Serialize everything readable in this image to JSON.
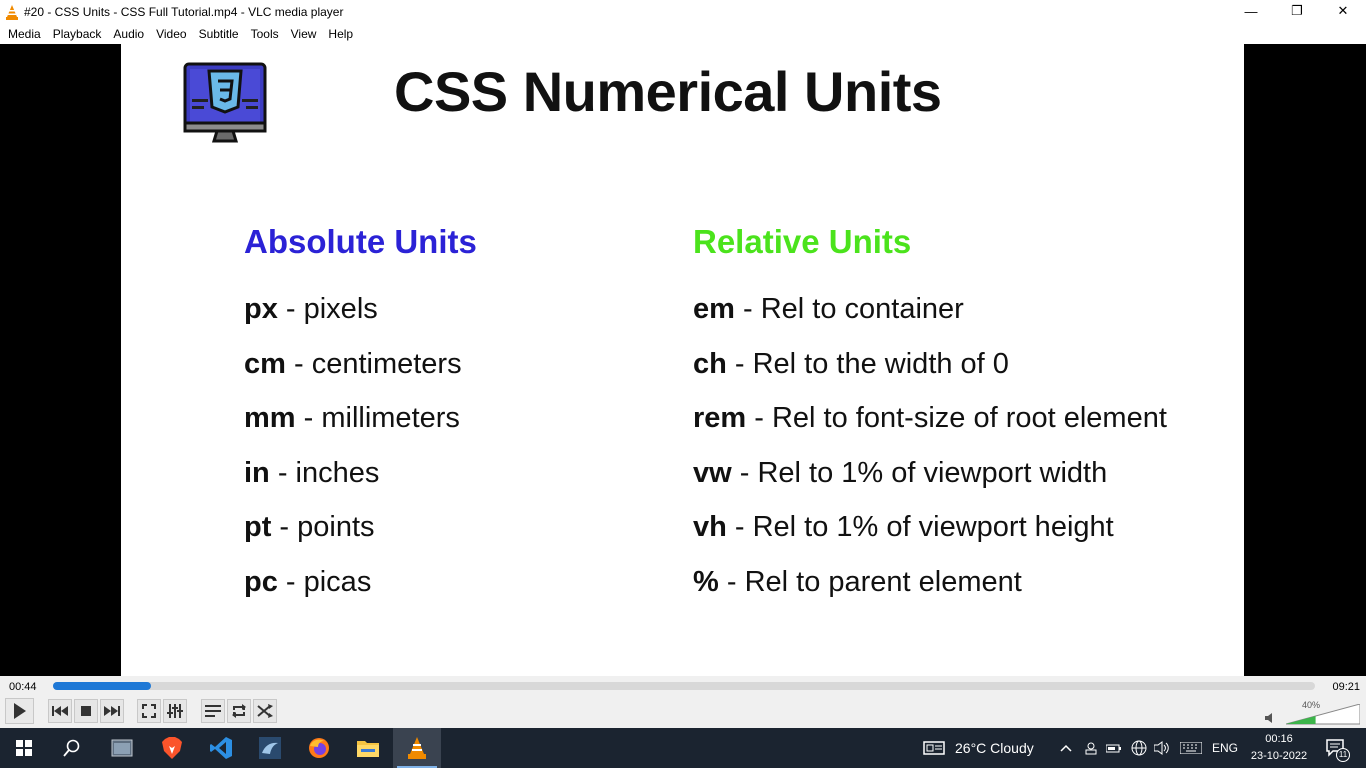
{
  "window": {
    "title": "#20 - CSS Units - CSS Full Tutorial.mp4 - VLC media player",
    "minimize_glyph": "—",
    "maximize_glyph": "❐",
    "close_glyph": "✕"
  },
  "menu": [
    "Media",
    "Playback",
    "Audio",
    "Video",
    "Subtitle",
    "Tools",
    "View",
    "Help"
  ],
  "slide": {
    "title": "CSS Numerical Units",
    "absolute": {
      "heading": "Absolute Units",
      "items": [
        {
          "unit": "px",
          "desc": " - pixels"
        },
        {
          "unit": "cm",
          "desc": " - centimeters"
        },
        {
          "unit": "mm",
          "desc": " - millimeters"
        },
        {
          "unit": "in",
          "desc": " - inches"
        },
        {
          "unit": "pt",
          "desc": " - points"
        },
        {
          "unit": "pc",
          "desc": " - picas"
        }
      ]
    },
    "relative": {
      "heading": "Relative Units",
      "items": [
        {
          "unit": "em",
          "desc": " - Rel to container"
        },
        {
          "unit": "ch",
          "desc": " - Rel to the width of 0"
        },
        {
          "unit": "rem",
          "desc": " - Rel to font-size of root element"
        },
        {
          "unit": "vw",
          "desc": " - Rel to 1% of viewport width"
        },
        {
          "unit": "vh",
          "desc": " - Rel to 1% of viewport height"
        },
        {
          "unit": "%",
          "desc": " - Rel to parent element"
        }
      ]
    }
  },
  "player": {
    "elapsed": "00:44",
    "total": "09:21",
    "progress_fraction": 0.078,
    "volume_percent": "40%",
    "volume_fraction": 0.4
  },
  "taskbar": {
    "weather": "26°C  Cloudy",
    "language": "ENG",
    "time": "00:16",
    "date": "23-10-2022",
    "notification_count": "11"
  },
  "colors": {
    "absolute_heading": "#2b22d6",
    "relative_heading": "#4be31c",
    "seek_fill": "#1e78d6",
    "taskbar_bg": "#1b2430"
  }
}
